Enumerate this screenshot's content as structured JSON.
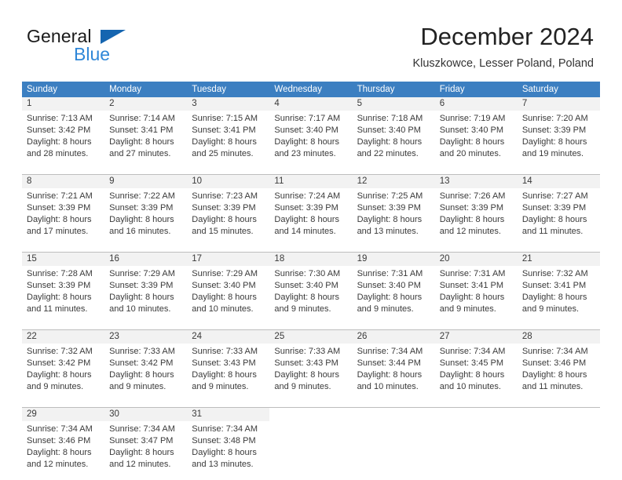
{
  "brand": {
    "name_dark": "General",
    "name_blue": "Blue",
    "triangle_color": "#1565b0",
    "blue_text_color": "#2f87d8"
  },
  "header": {
    "title": "December 2024",
    "subtitle": "Kluszkowce, Lesser Poland, Poland"
  },
  "colors": {
    "header_row_bg": "#3c7fc1",
    "header_row_text": "#ffffff",
    "day_number_bg": "#f2f2f2",
    "cell_bg": "#ffffff",
    "grid_line": "#bdbdbd",
    "body_text": "#3a3a3a"
  },
  "weekdays": [
    "Sunday",
    "Monday",
    "Tuesday",
    "Wednesday",
    "Thursday",
    "Friday",
    "Saturday"
  ],
  "weeks": [
    [
      {
        "day": "1",
        "lines": [
          "Sunrise: 7:13 AM",
          "Sunset: 3:42 PM",
          "Daylight: 8 hours",
          "and 28 minutes."
        ]
      },
      {
        "day": "2",
        "lines": [
          "Sunrise: 7:14 AM",
          "Sunset: 3:41 PM",
          "Daylight: 8 hours",
          "and 27 minutes."
        ]
      },
      {
        "day": "3",
        "lines": [
          "Sunrise: 7:15 AM",
          "Sunset: 3:41 PM",
          "Daylight: 8 hours",
          "and 25 minutes."
        ]
      },
      {
        "day": "4",
        "lines": [
          "Sunrise: 7:17 AM",
          "Sunset: 3:40 PM",
          "Daylight: 8 hours",
          "and 23 minutes."
        ]
      },
      {
        "day": "5",
        "lines": [
          "Sunrise: 7:18 AM",
          "Sunset: 3:40 PM",
          "Daylight: 8 hours",
          "and 22 minutes."
        ]
      },
      {
        "day": "6",
        "lines": [
          "Sunrise: 7:19 AM",
          "Sunset: 3:40 PM",
          "Daylight: 8 hours",
          "and 20 minutes."
        ]
      },
      {
        "day": "7",
        "lines": [
          "Sunrise: 7:20 AM",
          "Sunset: 3:39 PM",
          "Daylight: 8 hours",
          "and 19 minutes."
        ]
      }
    ],
    [
      {
        "day": "8",
        "lines": [
          "Sunrise: 7:21 AM",
          "Sunset: 3:39 PM",
          "Daylight: 8 hours",
          "and 17 minutes."
        ]
      },
      {
        "day": "9",
        "lines": [
          "Sunrise: 7:22 AM",
          "Sunset: 3:39 PM",
          "Daylight: 8 hours",
          "and 16 minutes."
        ]
      },
      {
        "day": "10",
        "lines": [
          "Sunrise: 7:23 AM",
          "Sunset: 3:39 PM",
          "Daylight: 8 hours",
          "and 15 minutes."
        ]
      },
      {
        "day": "11",
        "lines": [
          "Sunrise: 7:24 AM",
          "Sunset: 3:39 PM",
          "Daylight: 8 hours",
          "and 14 minutes."
        ]
      },
      {
        "day": "12",
        "lines": [
          "Sunrise: 7:25 AM",
          "Sunset: 3:39 PM",
          "Daylight: 8 hours",
          "and 13 minutes."
        ]
      },
      {
        "day": "13",
        "lines": [
          "Sunrise: 7:26 AM",
          "Sunset: 3:39 PM",
          "Daylight: 8 hours",
          "and 12 minutes."
        ]
      },
      {
        "day": "14",
        "lines": [
          "Sunrise: 7:27 AM",
          "Sunset: 3:39 PM",
          "Daylight: 8 hours",
          "and 11 minutes."
        ]
      }
    ],
    [
      {
        "day": "15",
        "lines": [
          "Sunrise: 7:28 AM",
          "Sunset: 3:39 PM",
          "Daylight: 8 hours",
          "and 11 minutes."
        ]
      },
      {
        "day": "16",
        "lines": [
          "Sunrise: 7:29 AM",
          "Sunset: 3:39 PM",
          "Daylight: 8 hours",
          "and 10 minutes."
        ]
      },
      {
        "day": "17",
        "lines": [
          "Sunrise: 7:29 AM",
          "Sunset: 3:40 PM",
          "Daylight: 8 hours",
          "and 10 minutes."
        ]
      },
      {
        "day": "18",
        "lines": [
          "Sunrise: 7:30 AM",
          "Sunset: 3:40 PM",
          "Daylight: 8 hours",
          "and 9 minutes."
        ]
      },
      {
        "day": "19",
        "lines": [
          "Sunrise: 7:31 AM",
          "Sunset: 3:40 PM",
          "Daylight: 8 hours",
          "and 9 minutes."
        ]
      },
      {
        "day": "20",
        "lines": [
          "Sunrise: 7:31 AM",
          "Sunset: 3:41 PM",
          "Daylight: 8 hours",
          "and 9 minutes."
        ]
      },
      {
        "day": "21",
        "lines": [
          "Sunrise: 7:32 AM",
          "Sunset: 3:41 PM",
          "Daylight: 8 hours",
          "and 9 minutes."
        ]
      }
    ],
    [
      {
        "day": "22",
        "lines": [
          "Sunrise: 7:32 AM",
          "Sunset: 3:42 PM",
          "Daylight: 8 hours",
          "and 9 minutes."
        ]
      },
      {
        "day": "23",
        "lines": [
          "Sunrise: 7:33 AM",
          "Sunset: 3:42 PM",
          "Daylight: 8 hours",
          "and 9 minutes."
        ]
      },
      {
        "day": "24",
        "lines": [
          "Sunrise: 7:33 AM",
          "Sunset: 3:43 PM",
          "Daylight: 8 hours",
          "and 9 minutes."
        ]
      },
      {
        "day": "25",
        "lines": [
          "Sunrise: 7:33 AM",
          "Sunset: 3:43 PM",
          "Daylight: 8 hours",
          "and 9 minutes."
        ]
      },
      {
        "day": "26",
        "lines": [
          "Sunrise: 7:34 AM",
          "Sunset: 3:44 PM",
          "Daylight: 8 hours",
          "and 10 minutes."
        ]
      },
      {
        "day": "27",
        "lines": [
          "Sunrise: 7:34 AM",
          "Sunset: 3:45 PM",
          "Daylight: 8 hours",
          "and 10 minutes."
        ]
      },
      {
        "day": "28",
        "lines": [
          "Sunrise: 7:34 AM",
          "Sunset: 3:46 PM",
          "Daylight: 8 hours",
          "and 11 minutes."
        ]
      }
    ],
    [
      {
        "day": "29",
        "lines": [
          "Sunrise: 7:34 AM",
          "Sunset: 3:46 PM",
          "Daylight: 8 hours",
          "and 12 minutes."
        ]
      },
      {
        "day": "30",
        "lines": [
          "Sunrise: 7:34 AM",
          "Sunset: 3:47 PM",
          "Daylight: 8 hours",
          "and 12 minutes."
        ]
      },
      {
        "day": "31",
        "lines": [
          "Sunrise: 7:34 AM",
          "Sunset: 3:48 PM",
          "Daylight: 8 hours",
          "and 13 minutes."
        ]
      },
      {
        "day": "",
        "lines": []
      },
      {
        "day": "",
        "lines": []
      },
      {
        "day": "",
        "lines": []
      },
      {
        "day": "",
        "lines": []
      }
    ]
  ]
}
